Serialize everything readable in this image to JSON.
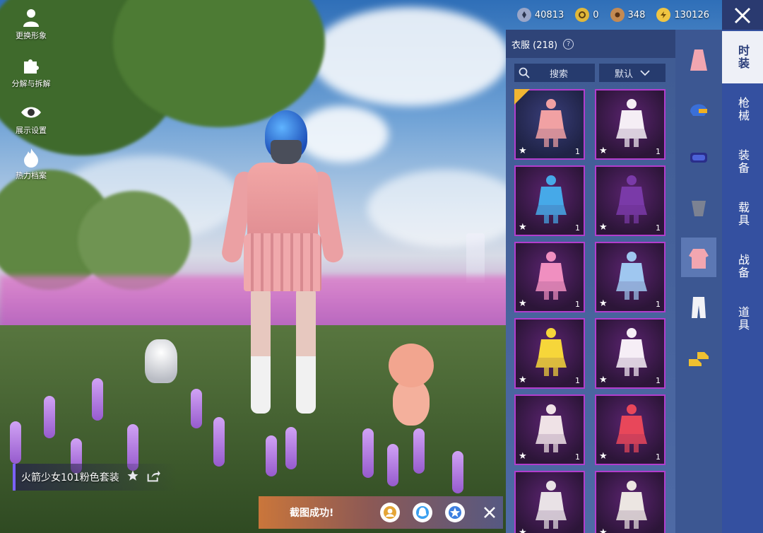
{
  "left_menu": [
    {
      "label": "更换形象",
      "icon": "person-icon"
    },
    {
      "label": "分解与拆解",
      "icon": "puzzle-icon"
    },
    {
      "label": "展示设置",
      "icon": "eye-icon"
    },
    {
      "label": "热力档案",
      "icon": "flame-icon"
    }
  ],
  "outfit": {
    "name": "火箭少女101粉色套装"
  },
  "toast": {
    "text": "截图成功!"
  },
  "currency": [
    {
      "icon": "silver-coin-icon",
      "value": "40813",
      "color": "#9aa6c8"
    },
    {
      "icon": "gold-token-icon",
      "value": "0",
      "color": "#e0b83a"
    },
    {
      "icon": "bronze-coin-icon",
      "value": "348",
      "color": "#c48a52"
    },
    {
      "icon": "lightning-coin-icon",
      "value": "130126",
      "color": "#f0c542"
    }
  ],
  "panel": {
    "title": "衣服 (218)",
    "search_label": "搜索",
    "sort_label": "默认"
  },
  "items": [
    {
      "count": "1",
      "selected": true,
      "tone": "#f1a1a3"
    },
    {
      "count": "1",
      "selected": false,
      "tone": "#f5eef5"
    },
    {
      "count": "1",
      "selected": false,
      "tone": "#46a9e8"
    },
    {
      "count": "1",
      "selected": false,
      "tone": "#7a3aa8"
    },
    {
      "count": "1",
      "selected": false,
      "tone": "#f08fc0"
    },
    {
      "count": "1",
      "selected": false,
      "tone": "#9fc7f0"
    },
    {
      "count": "1",
      "selected": false,
      "tone": "#f6d63a"
    },
    {
      "count": "1",
      "selected": false,
      "tone": "#f6eef6"
    },
    {
      "count": "1",
      "selected": false,
      "tone": "#efe2e6"
    },
    {
      "count": "1",
      "selected": false,
      "tone": "#e8475a"
    },
    {
      "count": "",
      "selected": false,
      "tone": "#e9e2e6"
    },
    {
      "count": "",
      "selected": false,
      "tone": "#ece6e2"
    }
  ],
  "categories": [
    {
      "icon": "dress-icon",
      "active": false
    },
    {
      "icon": "helmet-icon",
      "active": false
    },
    {
      "icon": "goggles-icon",
      "active": false
    },
    {
      "icon": "mask-icon",
      "active": false
    },
    {
      "icon": "jacket-icon",
      "active": true
    },
    {
      "icon": "pants-icon",
      "active": false
    },
    {
      "icon": "shoes-icon",
      "active": false
    }
  ],
  "tabs": [
    {
      "label": "时装",
      "active": true
    },
    {
      "label": "枪械",
      "active": false
    },
    {
      "label": "装备",
      "active": false
    },
    {
      "label": "载具",
      "active": false
    },
    {
      "label": "战备",
      "active": false
    },
    {
      "label": "道具",
      "active": false
    }
  ]
}
